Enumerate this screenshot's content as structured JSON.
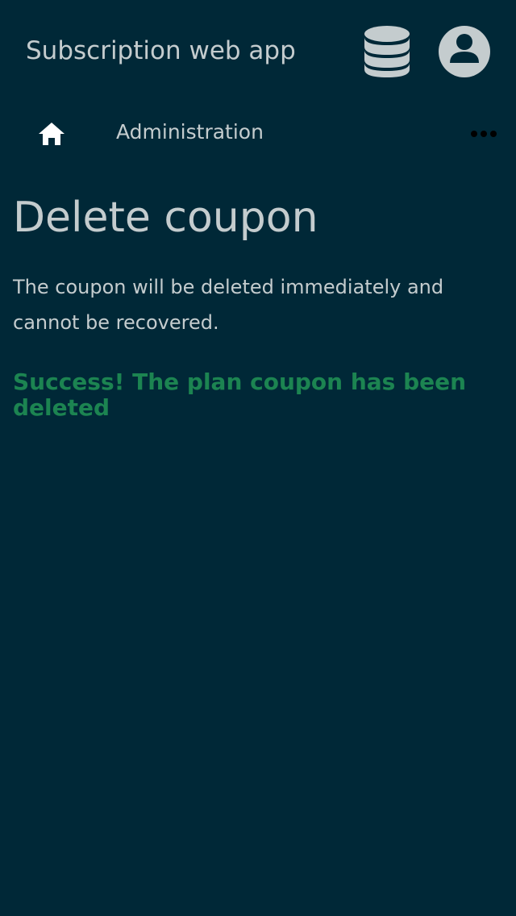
{
  "header": {
    "app_title": "Subscription web app",
    "database_icon": "database-icon",
    "account_icon": "account-circle-icon"
  },
  "nav": {
    "home_icon": "home-icon",
    "admin_label": "Administration",
    "more_icon": "more-horizontal-icon"
  },
  "main": {
    "title": "Delete coupon",
    "description": "The coupon will be deleted immediately and cannot be recovered.",
    "success_message": "Success! The plan coupon has been deleted"
  },
  "colors": {
    "background": "#002837",
    "text": "#c4ccce",
    "success": "#1c8451",
    "icon_light": "#c4ccce",
    "home_icon": "#ffffff",
    "more_icon": "#000000"
  }
}
